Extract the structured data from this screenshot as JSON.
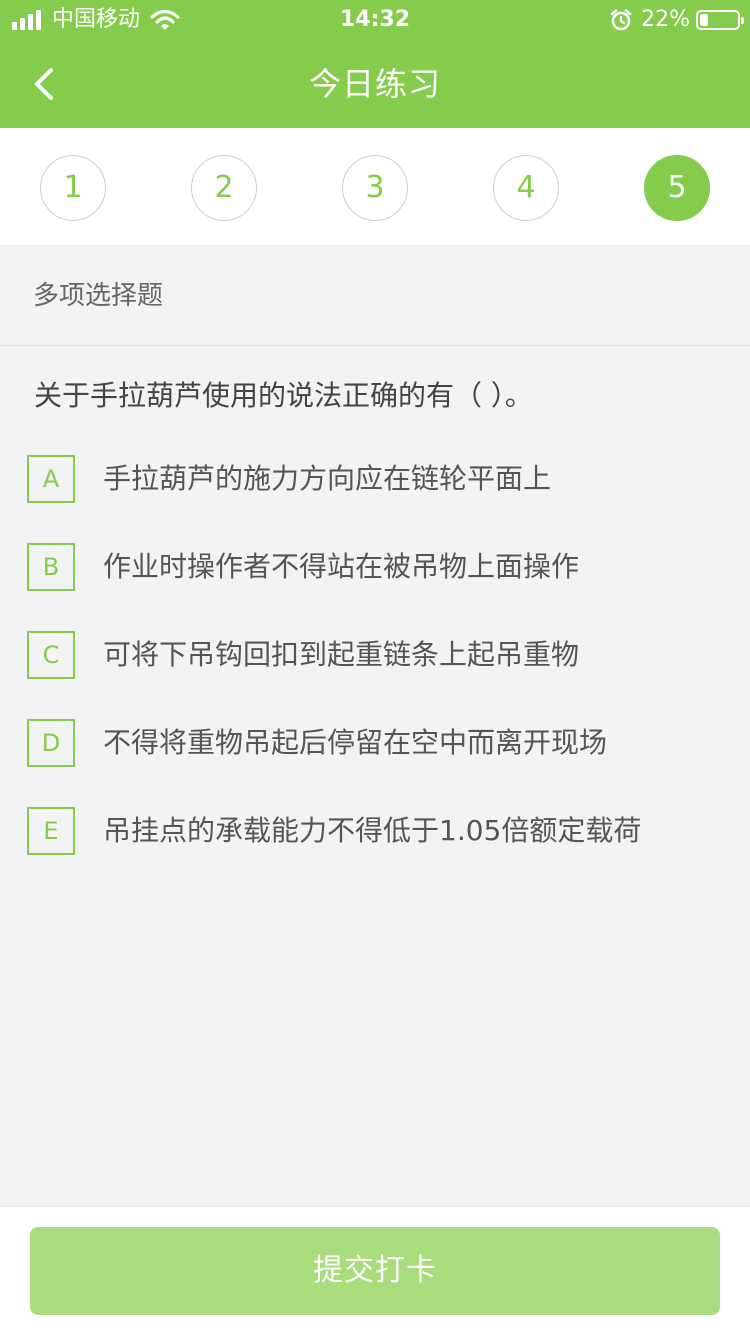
{
  "status_bar": {
    "carrier": "中国移动",
    "time": "14:32",
    "battery_percent": "22%",
    "battery_level": 0.22,
    "icons": [
      "signal-icon",
      "wifi-icon",
      "alarm-icon",
      "battery-icon"
    ]
  },
  "nav": {
    "title": "今日练习",
    "back_icon": "chevron-left-icon"
  },
  "steps": {
    "items": [
      "1",
      "2",
      "3",
      "4",
      "5"
    ],
    "active_index": 4
  },
  "question": {
    "type_label": "多项选择题",
    "text": "关于手拉葫芦使用的说法正确的有（    ）。",
    "options": [
      {
        "letter": "A",
        "text": "手拉葫芦的施力方向应在链轮平面上"
      },
      {
        "letter": "B",
        "text": "作业时操作者不得站在被吊物上面操作"
      },
      {
        "letter": "C",
        "text": "可将下吊钩回扣到起重链条上起吊重物"
      },
      {
        "letter": "D",
        "text": "不得将重物吊起后停留在空中而离开现场"
      },
      {
        "letter": "E",
        "text": "吊挂点的承载能力不得低于1.05倍额定载荷"
      }
    ]
  },
  "footer": {
    "submit_label": "提交打卡"
  },
  "colors": {
    "accent": "#86cc4c",
    "button_disabled": "#a8dc7c",
    "background": "#f2f3f5"
  }
}
